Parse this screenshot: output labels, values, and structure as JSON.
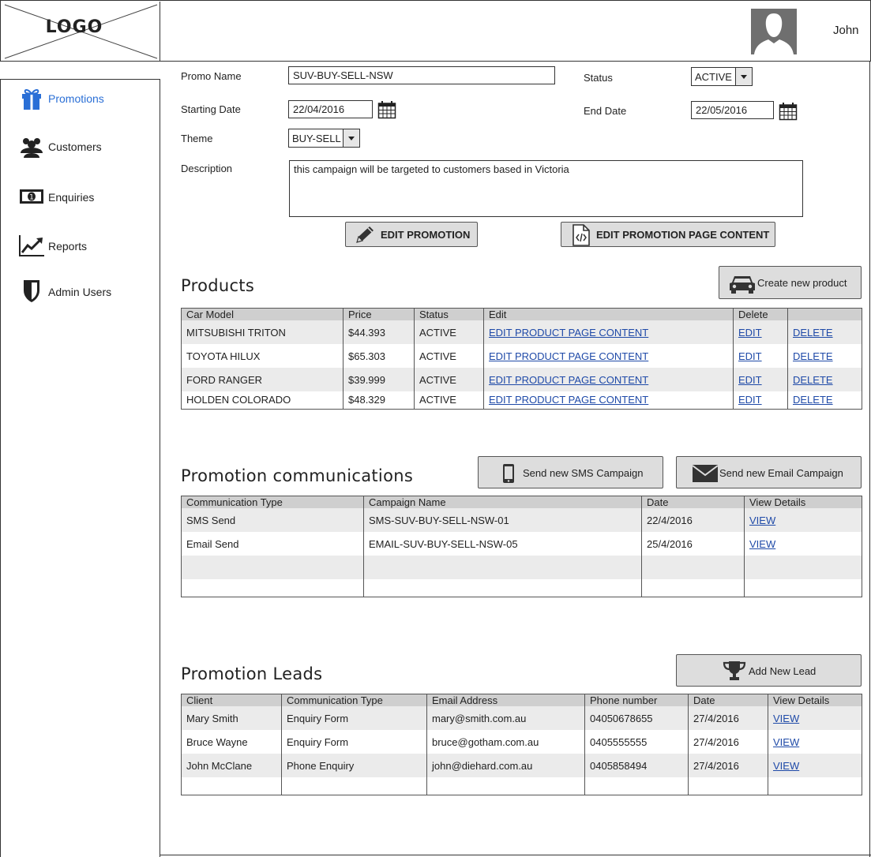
{
  "header": {
    "logo_text": "LOGO",
    "user_name": "John"
  },
  "sidebar": {
    "items": [
      {
        "label": "Promotions",
        "icon": "gift-icon",
        "active": true
      },
      {
        "label": "Customers",
        "icon": "users-icon"
      },
      {
        "label": "Enquiries",
        "icon": "money-icon"
      },
      {
        "label": "Reports",
        "icon": "chart-icon"
      },
      {
        "label": "Admin Users",
        "icon": "shield-icon"
      }
    ]
  },
  "form": {
    "promo_name_label": "Promo Name",
    "promo_name_value": "SUV-BUY-SELL-NSW",
    "status_label": "Status",
    "status_value": "ACTIVE",
    "start_date_label": "Starting Date",
    "start_date_value": "22/04/2016",
    "end_date_label": "End Date",
    "end_date_value": "22/05/2016",
    "theme_label": "Theme",
    "theme_value": "BUY-SELL",
    "description_label": "Description",
    "description_value": "this campaign will be targeted to customers based in Victoria",
    "edit_promotion_label": "EDIT PROMOTION",
    "edit_page_content_label": "EDIT PROMOTION PAGE CONTENT"
  },
  "products": {
    "title": "Products",
    "create_label": "Create new product",
    "headers": [
      "Car Model",
      "Price",
      "Status",
      "Edit",
      "Delete",
      ""
    ],
    "rows": [
      {
        "model": "MITSUBISHI TRITON",
        "price": "$44.393",
        "status": "ACTIVE",
        "edit_content": "EDIT PRODUCT PAGE CONTENT",
        "edit": "EDIT",
        "delete": "DELETE"
      },
      {
        "model": "TOYOTA HILUX",
        "price": "$65.303",
        "status": "ACTIVE",
        "edit_content": "EDIT PRODUCT PAGE CONTENT",
        "edit": "EDIT",
        "delete": "DELETE"
      },
      {
        "model": "FORD RANGER",
        "price": "$39.999",
        "status": "ACTIVE",
        "edit_content": "EDIT PRODUCT PAGE CONTENT",
        "edit": "EDIT",
        "delete": "DELETE"
      },
      {
        "model": "HOLDEN COLORADO",
        "price": "$48.329",
        "status": "ACTIVE",
        "edit_content": "EDIT PRODUCT PAGE CONTENT",
        "edit": "EDIT",
        "delete": "DELETE"
      }
    ]
  },
  "communications": {
    "title": "Promotion communications",
    "sms_button_label": "Send new SMS Campaign",
    "email_button_label": "Send new Email Campaign",
    "headers": [
      "Communication Type",
      "Campaign Name",
      "Date",
      "View Details"
    ],
    "rows": [
      {
        "type": "SMS Send",
        "campaign": "SMS-SUV-BUY-SELL-NSW-01",
        "date": "22/4/2016",
        "view": "VIEW"
      },
      {
        "type": "Email Send",
        "campaign": "EMAIL-SUV-BUY-SELL-NSW-05",
        "date": "25/4/2016",
        "view": "VIEW"
      }
    ]
  },
  "leads": {
    "title": "Promotion Leads",
    "add_label": "Add New Lead",
    "headers": [
      "Client",
      "Communication Type",
      "Email Address",
      "Phone number",
      "Date",
      "View Details"
    ],
    "rows": [
      {
        "client": "Mary Smith",
        "type": "Enquiry Form",
        "email": "mary@smith.com.au",
        "phone": "04050678655",
        "date": "27/4/2016",
        "view": "VIEW"
      },
      {
        "client": "Bruce Wayne",
        "type": "Enquiry Form",
        "email": "bruce@gotham.com.au",
        "phone": "0405555555",
        "date": "27/4/2016",
        "view": "VIEW"
      },
      {
        "client": "John McClane",
        "type": "Phone Enquiry",
        "email": "john@diehard.com.au",
        "phone": "0405858494",
        "date": "27/4/2016",
        "view": "VIEW"
      }
    ]
  },
  "colors": {
    "active_nav": "#2a6fd6",
    "link": "#1f4aa8",
    "header_row": "#cfcfcf",
    "alt_row": "#ebebeb",
    "button": "#dddddd"
  }
}
